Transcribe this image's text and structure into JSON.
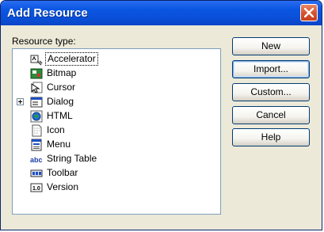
{
  "window": {
    "title": "Add Resource"
  },
  "label": "Resource type:",
  "tree": [
    {
      "label": "Accelerator",
      "icon": "accelerator-icon",
      "selected": true
    },
    {
      "label": "Bitmap",
      "icon": "bitmap-icon"
    },
    {
      "label": "Cursor",
      "icon": "cursor-icon"
    },
    {
      "label": "Dialog",
      "icon": "dialog-icon",
      "expandable": true
    },
    {
      "label": "HTML",
      "icon": "html-icon"
    },
    {
      "label": "Icon",
      "icon": "icon-resource-icon"
    },
    {
      "label": "Menu",
      "icon": "menu-icon"
    },
    {
      "label": "String Table",
      "icon": "string-table-icon"
    },
    {
      "label": "Toolbar",
      "icon": "toolbar-icon"
    },
    {
      "label": "Version",
      "icon": "version-icon"
    }
  ],
  "buttons": {
    "new": "New",
    "import": "Import...",
    "custom": "Custom...",
    "cancel": "Cancel",
    "help": "Help"
  },
  "colors": {
    "titlebar": "#0a4fd8",
    "close": "#d6502b",
    "face": "#ece9d8"
  }
}
